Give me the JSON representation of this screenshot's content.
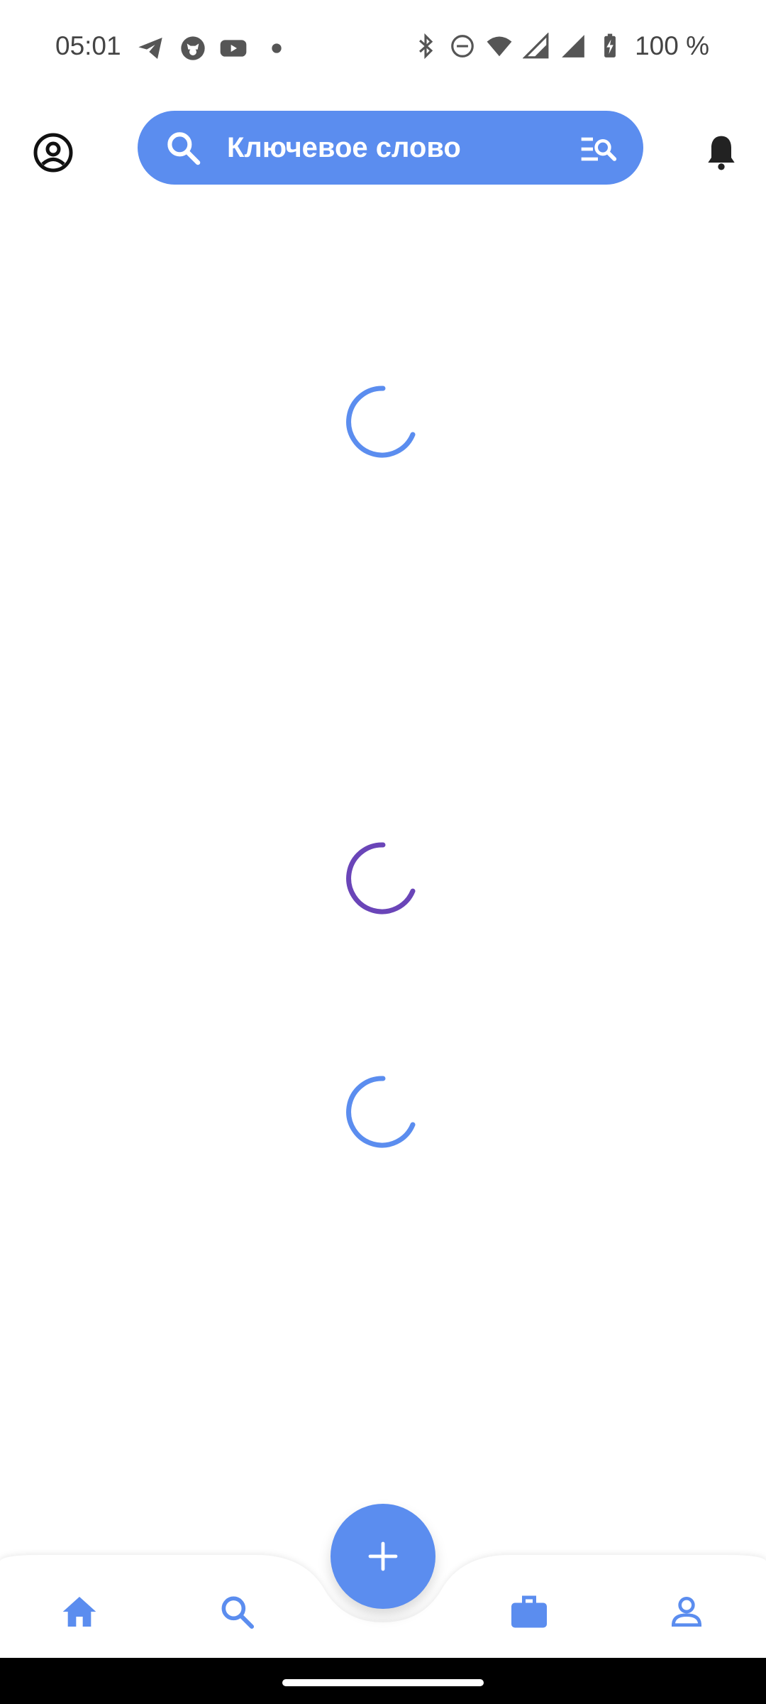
{
  "status_bar": {
    "time": "05:01",
    "battery": "100 %",
    "left_icons": [
      "telegram-icon",
      "cat-icon",
      "youtube-icon",
      "dot-icon"
    ],
    "right_icons": [
      "bluetooth-icon",
      "dnd-icon",
      "wifi-icon",
      "signal-icon",
      "signal-icon",
      "battery-charging-icon"
    ]
  },
  "header": {
    "search_placeholder": "Ключевое слово",
    "account_icon": "account-circle-icon",
    "search_icon": "search-icon",
    "filter_icon": "search-filter-icon",
    "bell_icon": "bell-icon"
  },
  "loaders": [
    {
      "color": "#5b8def"
    },
    {
      "color": "#6a45b8"
    },
    {
      "color": "#5b8def"
    }
  ],
  "bottom_nav": {
    "items": [
      "home-icon",
      "search-icon",
      "briefcase-icon",
      "person-icon"
    ],
    "fab": "plus-icon",
    "accent": "#5b8def"
  }
}
